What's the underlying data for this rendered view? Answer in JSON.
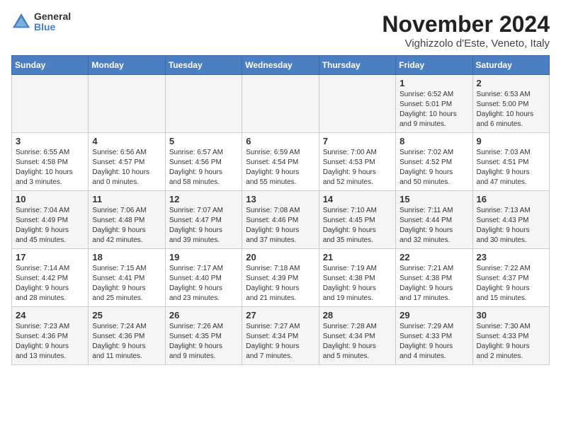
{
  "logo": {
    "general": "General",
    "blue": "Blue"
  },
  "title": "November 2024",
  "location": "Vighizzolo d'Este, Veneto, Italy",
  "weekdays": [
    "Sunday",
    "Monday",
    "Tuesday",
    "Wednesday",
    "Thursday",
    "Friday",
    "Saturday"
  ],
  "weeks": [
    [
      {
        "day": "",
        "info": ""
      },
      {
        "day": "",
        "info": ""
      },
      {
        "day": "",
        "info": ""
      },
      {
        "day": "",
        "info": ""
      },
      {
        "day": "",
        "info": ""
      },
      {
        "day": "1",
        "info": "Sunrise: 6:52 AM\nSunset: 5:01 PM\nDaylight: 10 hours\nand 9 minutes."
      },
      {
        "day": "2",
        "info": "Sunrise: 6:53 AM\nSunset: 5:00 PM\nDaylight: 10 hours\nand 6 minutes."
      }
    ],
    [
      {
        "day": "3",
        "info": "Sunrise: 6:55 AM\nSunset: 4:58 PM\nDaylight: 10 hours\nand 3 minutes."
      },
      {
        "day": "4",
        "info": "Sunrise: 6:56 AM\nSunset: 4:57 PM\nDaylight: 10 hours\nand 0 minutes."
      },
      {
        "day": "5",
        "info": "Sunrise: 6:57 AM\nSunset: 4:56 PM\nDaylight: 9 hours\nand 58 minutes."
      },
      {
        "day": "6",
        "info": "Sunrise: 6:59 AM\nSunset: 4:54 PM\nDaylight: 9 hours\nand 55 minutes."
      },
      {
        "day": "7",
        "info": "Sunrise: 7:00 AM\nSunset: 4:53 PM\nDaylight: 9 hours\nand 52 minutes."
      },
      {
        "day": "8",
        "info": "Sunrise: 7:02 AM\nSunset: 4:52 PM\nDaylight: 9 hours\nand 50 minutes."
      },
      {
        "day": "9",
        "info": "Sunrise: 7:03 AM\nSunset: 4:51 PM\nDaylight: 9 hours\nand 47 minutes."
      }
    ],
    [
      {
        "day": "10",
        "info": "Sunrise: 7:04 AM\nSunset: 4:49 PM\nDaylight: 9 hours\nand 45 minutes."
      },
      {
        "day": "11",
        "info": "Sunrise: 7:06 AM\nSunset: 4:48 PM\nDaylight: 9 hours\nand 42 minutes."
      },
      {
        "day": "12",
        "info": "Sunrise: 7:07 AM\nSunset: 4:47 PM\nDaylight: 9 hours\nand 39 minutes."
      },
      {
        "day": "13",
        "info": "Sunrise: 7:08 AM\nSunset: 4:46 PM\nDaylight: 9 hours\nand 37 minutes."
      },
      {
        "day": "14",
        "info": "Sunrise: 7:10 AM\nSunset: 4:45 PM\nDaylight: 9 hours\nand 35 minutes."
      },
      {
        "day": "15",
        "info": "Sunrise: 7:11 AM\nSunset: 4:44 PM\nDaylight: 9 hours\nand 32 minutes."
      },
      {
        "day": "16",
        "info": "Sunrise: 7:13 AM\nSunset: 4:43 PM\nDaylight: 9 hours\nand 30 minutes."
      }
    ],
    [
      {
        "day": "17",
        "info": "Sunrise: 7:14 AM\nSunset: 4:42 PM\nDaylight: 9 hours\nand 28 minutes."
      },
      {
        "day": "18",
        "info": "Sunrise: 7:15 AM\nSunset: 4:41 PM\nDaylight: 9 hours\nand 25 minutes."
      },
      {
        "day": "19",
        "info": "Sunrise: 7:17 AM\nSunset: 4:40 PM\nDaylight: 9 hours\nand 23 minutes."
      },
      {
        "day": "20",
        "info": "Sunrise: 7:18 AM\nSunset: 4:39 PM\nDaylight: 9 hours\nand 21 minutes."
      },
      {
        "day": "21",
        "info": "Sunrise: 7:19 AM\nSunset: 4:38 PM\nDaylight: 9 hours\nand 19 minutes."
      },
      {
        "day": "22",
        "info": "Sunrise: 7:21 AM\nSunset: 4:38 PM\nDaylight: 9 hours\nand 17 minutes."
      },
      {
        "day": "23",
        "info": "Sunrise: 7:22 AM\nSunset: 4:37 PM\nDaylight: 9 hours\nand 15 minutes."
      }
    ],
    [
      {
        "day": "24",
        "info": "Sunrise: 7:23 AM\nSunset: 4:36 PM\nDaylight: 9 hours\nand 13 minutes."
      },
      {
        "day": "25",
        "info": "Sunrise: 7:24 AM\nSunset: 4:36 PM\nDaylight: 9 hours\nand 11 minutes."
      },
      {
        "day": "26",
        "info": "Sunrise: 7:26 AM\nSunset: 4:35 PM\nDaylight: 9 hours\nand 9 minutes."
      },
      {
        "day": "27",
        "info": "Sunrise: 7:27 AM\nSunset: 4:34 PM\nDaylight: 9 hours\nand 7 minutes."
      },
      {
        "day": "28",
        "info": "Sunrise: 7:28 AM\nSunset: 4:34 PM\nDaylight: 9 hours\nand 5 minutes."
      },
      {
        "day": "29",
        "info": "Sunrise: 7:29 AM\nSunset: 4:33 PM\nDaylight: 9 hours\nand 4 minutes."
      },
      {
        "day": "30",
        "info": "Sunrise: 7:30 AM\nSunset: 4:33 PM\nDaylight: 9 hours\nand 2 minutes."
      }
    ]
  ]
}
